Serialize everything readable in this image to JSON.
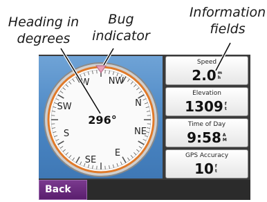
{
  "annotations": {
    "heading": [
      "Heading in",
      "degrees"
    ],
    "bug": [
      "Bug",
      "indicator"
    ],
    "fields": [
      "Information",
      "fields"
    ]
  },
  "compass": {
    "heading_readout": "296°",
    "cardinal_labels": [
      "N",
      "NE",
      "E",
      "SE",
      "S",
      "SW",
      "W",
      "NW"
    ],
    "heading_degrees": 296
  },
  "fields": [
    {
      "label": "Speed",
      "value": "2.0",
      "unit": [
        "m",
        "h"
      ]
    },
    {
      "label": "Elevation",
      "value": "1309",
      "unit": [
        "f",
        "t"
      ]
    },
    {
      "label": "Time of Day",
      "value": "9:58",
      "unit": [
        "A",
        "M"
      ]
    },
    {
      "label": "GPS Accuracy",
      "value": "10",
      "unit": [
        "f",
        "t"
      ]
    }
  ],
  "footer": {
    "back_label": "Back"
  },
  "colors": {
    "compass_background": "#4a86c4",
    "compass_ring": "#e07a2a",
    "bug_marker": "#e8a0b8",
    "back_button": "#6a2a7e"
  }
}
